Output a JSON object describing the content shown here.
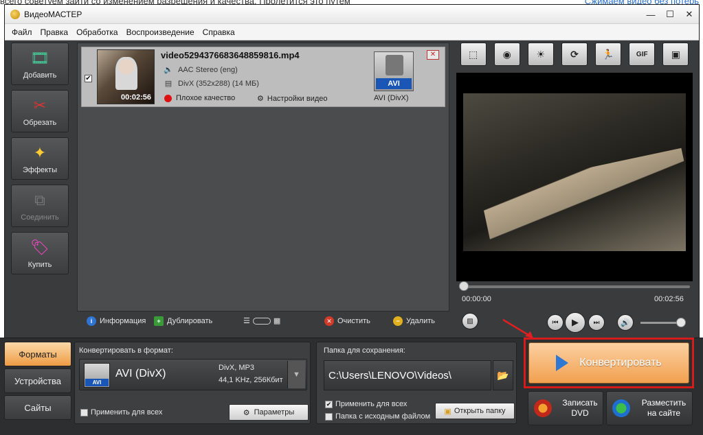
{
  "background": {
    "top_text": "всего советуем зайти со изменением разрешения и качества. Пролетится это путем",
    "right_text": "Сжимаем видео без потерь"
  },
  "window": {
    "title": "ВидеоМАСТЕР",
    "controls": {
      "minimize": "—",
      "maximize": "☐",
      "close": "✕"
    }
  },
  "menu": [
    "Файл",
    "Правка",
    "Обработка",
    "Воспроизведение",
    "Справка"
  ],
  "tools": [
    {
      "label": "Добавить",
      "icon": "add-video-icon",
      "enabled": true
    },
    {
      "label": "Обрезать",
      "icon": "cut-icon",
      "enabled": true
    },
    {
      "label": "Эффекты",
      "icon": "effects-icon",
      "enabled": true
    },
    {
      "label": "Соединить",
      "icon": "join-icon",
      "enabled": false
    },
    {
      "label": "Купить",
      "icon": "buy-icon",
      "enabled": true
    }
  ],
  "file": {
    "name": "video5294376683648859816.mp4",
    "audio": "AAC Stereo (eng)",
    "video": "DivX (352x288) (14 МБ)",
    "duration": "00:02:56",
    "quality": "Плохое качество",
    "settings": "Настройки видео",
    "format_badge": "AVI",
    "format_name": "AVI (DivX)",
    "checked": "✔"
  },
  "list_toolbar": {
    "info": "Информация",
    "duplicate": "Дублировать",
    "clear": "Очистить",
    "delete": "Удалить"
  },
  "preview_tools": [
    "crop-icon",
    "snapshot-icon",
    "brightness-icon",
    "rotate-icon",
    "speed-icon",
    "GIF",
    "fullscreen-icon"
  ],
  "player": {
    "time_current": "00:00:00",
    "time_total": "00:02:56",
    "progress": 0.0,
    "volume": 0.95
  },
  "side_tabs": [
    "Форматы",
    "Устройства",
    "Сайты"
  ],
  "format_box": {
    "title": "Конвертировать в формат:",
    "format_name": "AVI (DivX)",
    "badge": "AVI",
    "spec1": "DivX, MP3",
    "spec2": "44,1 KHz, 256Кбит",
    "apply_all": "Применить для всех",
    "params": "Параметры"
  },
  "save_box": {
    "title": "Папка для сохранения:",
    "path": "C:\\Users\\LENOVO\\Videos\\",
    "apply_all": "Применить для всех",
    "same_folder": "Папка с исходным файлом",
    "open": "Открыть папку"
  },
  "actions": {
    "convert": "Конвертировать",
    "dvd_line1": "Записать",
    "dvd_line2": "DVD",
    "site_line1": "Разместить",
    "site_line2": "на сайте"
  },
  "colors": {
    "accent_orange": "#f2a04f",
    "highlight_red": "#d61b1b",
    "play_blue": "#2e78d4"
  }
}
